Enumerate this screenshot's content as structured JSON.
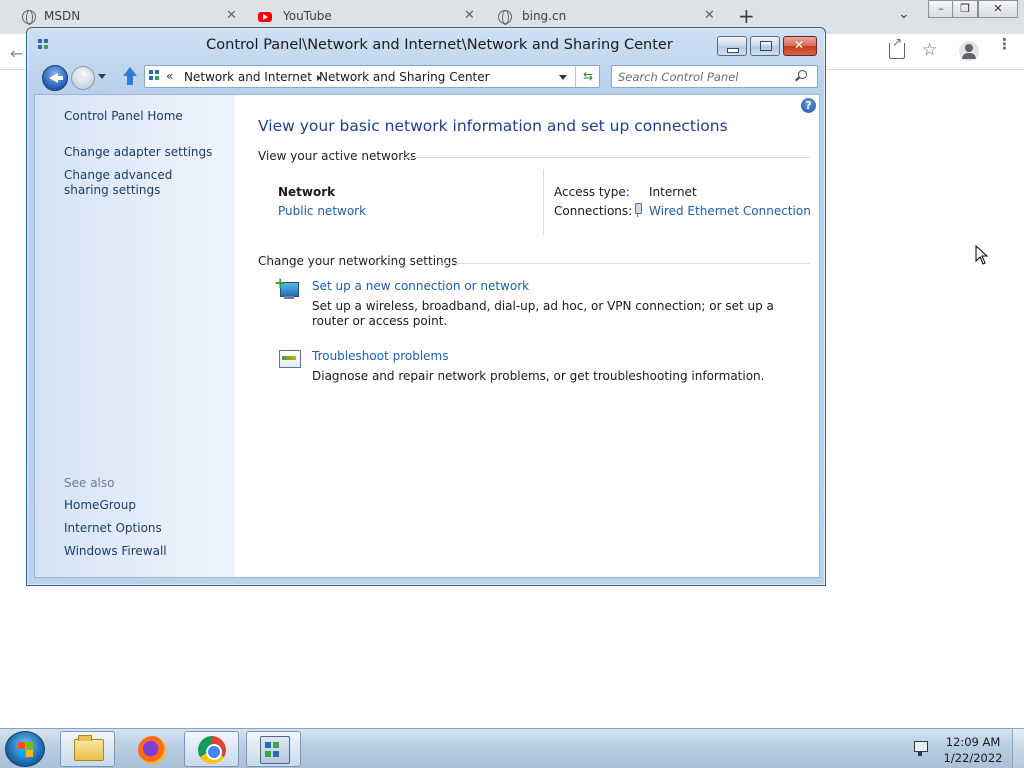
{
  "browser": {
    "tabs": [
      {
        "title": "MSDN",
        "icon": "globe-icon"
      },
      {
        "title": "YouTube",
        "icon": "youtube-icon"
      },
      {
        "title": "bing.cn",
        "icon": "globe-icon"
      }
    ],
    "tab_close_glyph": "✕",
    "new_tab_glyph": "+"
  },
  "window": {
    "title": "Control Panel\\Network and Internet\\Network and Sharing Center",
    "address": {
      "chevron": "«",
      "crumbs": [
        "Network and Internet",
        "Network and Sharing Center"
      ]
    },
    "search_placeholder": "Search Control Panel"
  },
  "sidebar": {
    "home": "Control Panel Home",
    "links": [
      "Change adapter settings",
      "Change advanced sharing settings"
    ],
    "see_also_label": "See also",
    "see_also": [
      "HomeGroup",
      "Internet Options",
      "Windows Firewall"
    ]
  },
  "main": {
    "title": "View your basic network information and set up connections",
    "active_networks_heading": "View your active networks",
    "network": {
      "name": "Network",
      "type": "Public network",
      "access_type_label": "Access type:",
      "access_type_value": "Internet",
      "connections_label": "Connections:",
      "connection_name": "Wired Ethernet Connection"
    },
    "settings_heading": "Change your networking settings",
    "tasks": [
      {
        "title": "Set up a new connection or network",
        "desc": "Set up a wireless, broadband, dial-up, ad hoc, or VPN connection; or set up a router or access point.",
        "icon": "network-setup-icon"
      },
      {
        "title": "Troubleshoot problems",
        "desc": "Diagnose and repair network problems, or get troubleshooting information.",
        "icon": "troubleshoot-icon"
      }
    ],
    "help_glyph": "?"
  },
  "taskbar": {
    "clock_time": "12:09 AM",
    "clock_date": "1/22/2022"
  },
  "colors": {
    "link": "#1f5ea8",
    "title_blue": "#1e3f8a",
    "close_red": "#c4391f"
  }
}
